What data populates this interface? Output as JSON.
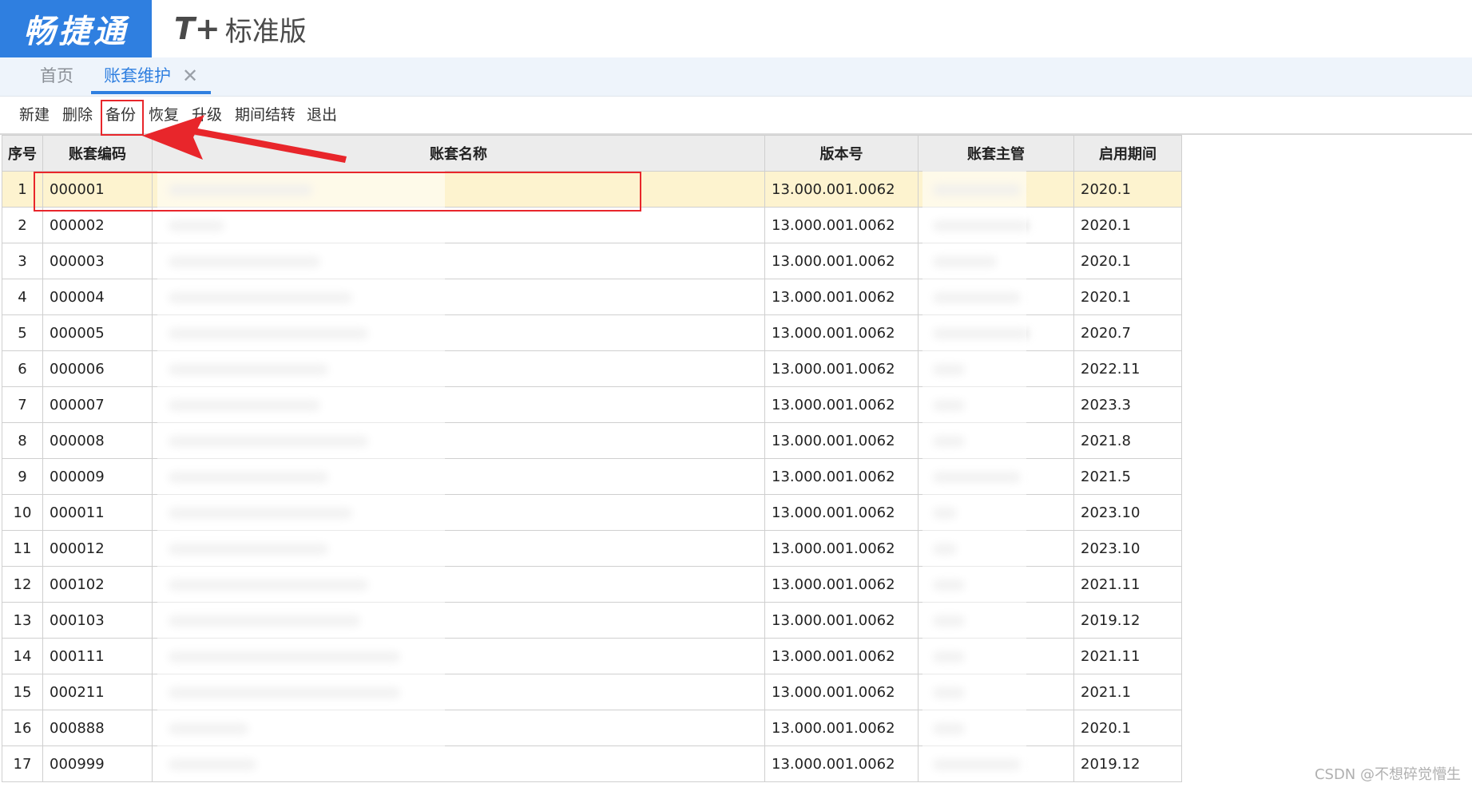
{
  "header": {
    "logo": "畅捷通",
    "product_mark": "T+",
    "edition": "标准版"
  },
  "tabs": {
    "home": "首页",
    "active": "账套维护",
    "close_glyph": "✕"
  },
  "toolbar": {
    "new": "新建",
    "delete": "删除",
    "backup": "备份",
    "restore": "恢复",
    "upgrade": "升级",
    "period_close": "期间结转",
    "exit": "退出"
  },
  "table": {
    "columns": {
      "idx": "序号",
      "code": "账套编码",
      "name": "账套名称",
      "version": "版本号",
      "manager": "账套主管",
      "start": "启用期间"
    },
    "rows": [
      {
        "idx": "1",
        "code": "000001",
        "version": "13.000.001.0062",
        "start": "2020.1"
      },
      {
        "idx": "2",
        "code": "000002",
        "version": "13.000.001.0062",
        "start": "2020.1"
      },
      {
        "idx": "3",
        "code": "000003",
        "version": "13.000.001.0062",
        "start": "2020.1"
      },
      {
        "idx": "4",
        "code": "000004",
        "version": "13.000.001.0062",
        "start": "2020.1"
      },
      {
        "idx": "5",
        "code": "000005",
        "version": "13.000.001.0062",
        "start": "2020.7"
      },
      {
        "idx": "6",
        "code": "000006",
        "version": "13.000.001.0062",
        "start": "2022.11"
      },
      {
        "idx": "7",
        "code": "000007",
        "version": "13.000.001.0062",
        "start": "2023.3"
      },
      {
        "idx": "8",
        "code": "000008",
        "version": "13.000.001.0062",
        "start": "2021.8"
      },
      {
        "idx": "9",
        "code": "000009",
        "version": "13.000.001.0062",
        "start": "2021.5"
      },
      {
        "idx": "10",
        "code": "000011",
        "version": "13.000.001.0062",
        "start": "2023.10"
      },
      {
        "idx": "11",
        "code": "000012",
        "version": "13.000.001.0062",
        "start": "2023.10"
      },
      {
        "idx": "12",
        "code": "000102",
        "version": "13.000.001.0062",
        "start": "2021.11"
      },
      {
        "idx": "13",
        "code": "000103",
        "version": "13.000.001.0062",
        "start": "2019.12"
      },
      {
        "idx": "14",
        "code": "000111",
        "version": "13.000.001.0062",
        "start": "2021.11"
      },
      {
        "idx": "15",
        "code": "000211",
        "version": "13.000.001.0062",
        "start": "2021.1"
      },
      {
        "idx": "16",
        "code": "000888",
        "version": "13.000.001.0062",
        "start": "2020.1"
      },
      {
        "idx": "17",
        "code": "000999",
        "version": "13.000.001.0062",
        "start": "2019.12"
      }
    ],
    "selected_row": 1
  },
  "watermark": "CSDN @不想碎觉懵生",
  "colors": {
    "brand_blue": "#2f7fe0",
    "selected_row": "#fdf3cf",
    "annotation_red": "#e8262b"
  }
}
